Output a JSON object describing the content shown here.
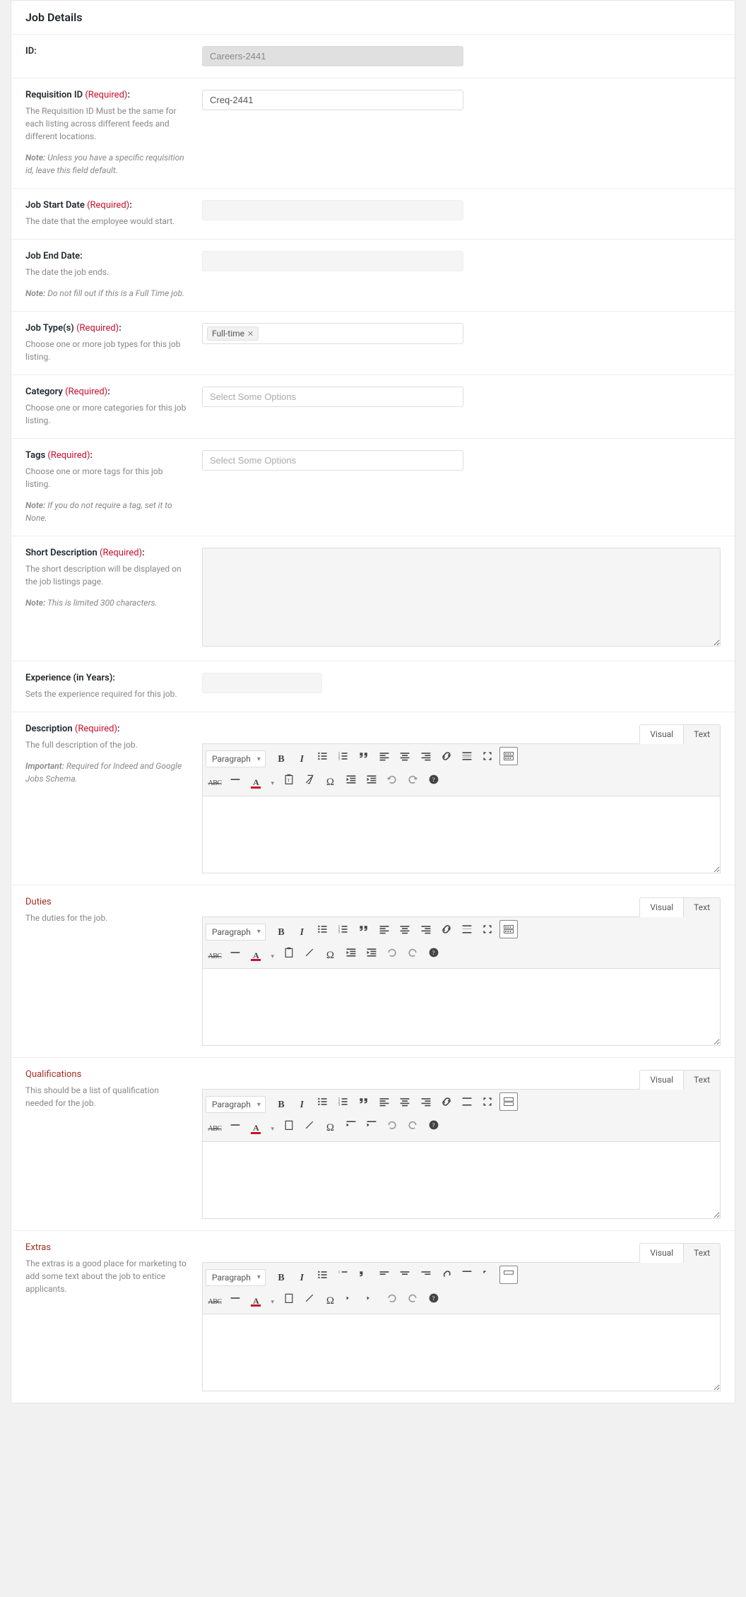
{
  "panel": {
    "title": "Job Details"
  },
  "required_label": "(Required)",
  "tabs": {
    "visual": "Visual",
    "text": "Text"
  },
  "format_select": "Paragraph",
  "fields": {
    "id": {
      "label": "ID:",
      "value": "Careers-2441"
    },
    "req_id": {
      "label": "Requisition ID",
      "value": "Creq-2441",
      "desc": "The Requisition ID Must be the same for each listing across different feeds and different locations.",
      "note_label": "Note:",
      "note": "Unless you have a specific requisition id, leave this field default."
    },
    "start_date": {
      "label": "Job Start Date",
      "desc": "The date that the employee would start."
    },
    "end_date": {
      "label": "Job End Date:",
      "desc": "The date the job ends.",
      "note_label": "Note:",
      "note": "Do not fill out if this is a Full Time job."
    },
    "job_types": {
      "label": "Job Type(s)",
      "desc": "Choose one or more job types for this job listing.",
      "tag": "Full-time"
    },
    "category": {
      "label": "Category",
      "desc": "Choose one or more categories for this job listing.",
      "placeholder": "Select Some Options"
    },
    "tags": {
      "label": "Tags",
      "desc": "Choose one or more tags for this job listing.",
      "note_label": "Note:",
      "note": "If you do not require a tag, set it to None.",
      "placeholder": "Select Some Options"
    },
    "short_desc": {
      "label": "Short Description",
      "desc": "The short description will be displayed on the job listings page.",
      "note_label": "Note:",
      "note": "This is limited 300 characters."
    },
    "experience": {
      "label": "Experience (in Years):",
      "desc": "Sets the experience required for this job."
    },
    "description": {
      "label": "Description",
      "desc": "The full description of the job.",
      "important_label": "Important:",
      "important": "Required for Indeed and Google Jobs Schema."
    },
    "duties": {
      "title": "Duties",
      "desc": "The duties for the job."
    },
    "qualifications": {
      "title": "Qualifications",
      "desc": "This should be a list of qualification needed for the job."
    },
    "extras": {
      "title": "Extras",
      "desc": "The extras is a good place for marketing to add some text about the job to entice applicants."
    }
  }
}
